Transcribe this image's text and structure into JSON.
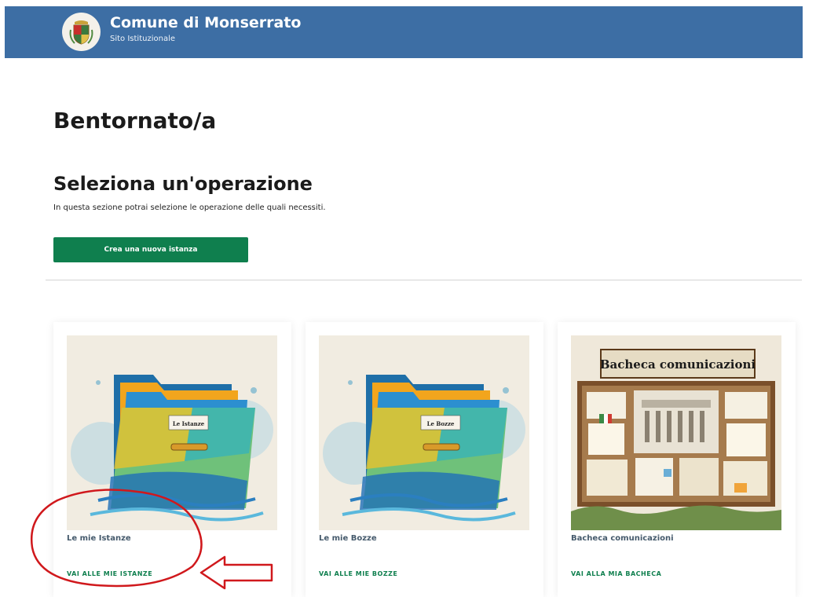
{
  "header": {
    "site_name": "Comune di Monserrato",
    "site_subtitle": "Sito Istituzionale",
    "background_color": "#3d6ea4"
  },
  "main": {
    "welcome_title": "Bentornato/a",
    "section_title": "Seleziona un'operazione",
    "section_description": "In questa sezione potrai selezione le operazione delle quali necessiti.",
    "create_button_label": "Crea una nuova istanza",
    "accent_color": "#0f7f4e"
  },
  "cards": [
    {
      "title": "Le mie Istanze",
      "link_label": "VAI ALLE MIE ISTANZE",
      "image_label": "Le Istanze",
      "icon": "folder-icon"
    },
    {
      "title": "Le mie Bozze",
      "link_label": "VAI ALLE MIE BOZZE",
      "image_label": "Le Bozze",
      "icon": "folder-icon"
    },
    {
      "title": "Bacheca comunicazioni",
      "link_label": "VAI ALLA MIA BACHECA",
      "image_label": "Bacheca comunicazioni",
      "icon": "bulletin-board-icon"
    }
  ],
  "annotation": {
    "color": "#d0181c"
  }
}
